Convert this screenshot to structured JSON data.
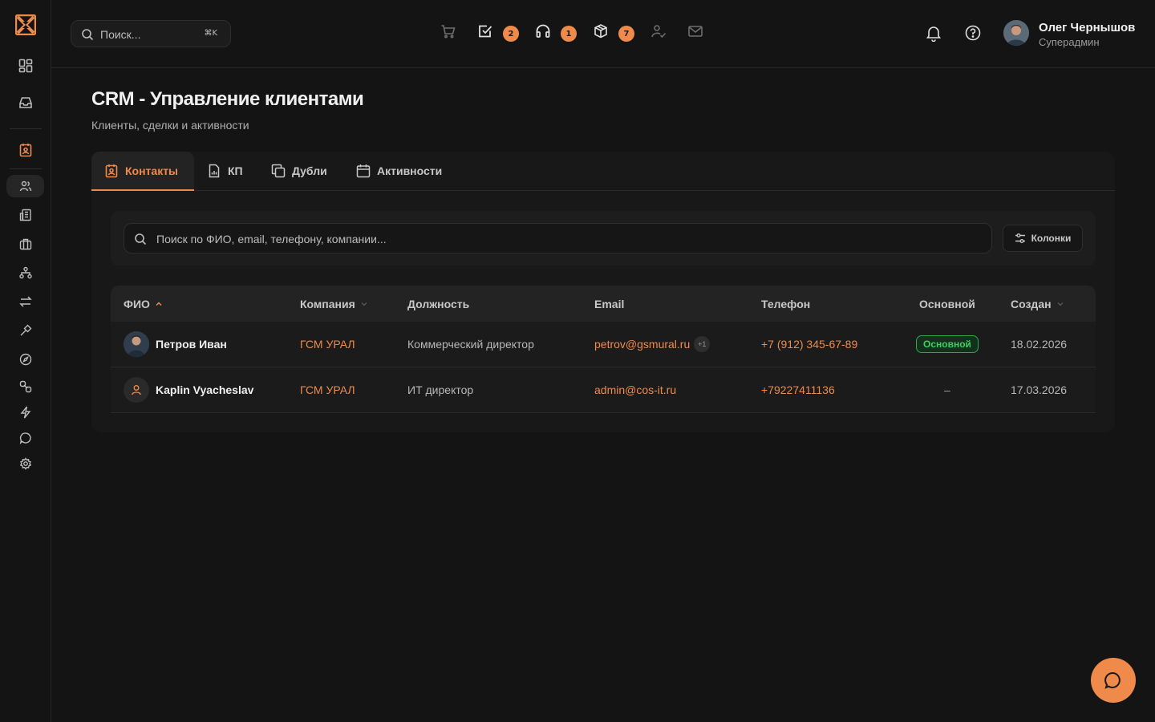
{
  "header": {
    "search": {
      "placeholder": "Поиск...",
      "shortcut": "⌘K"
    },
    "icons": [
      {
        "name": "cart-icon",
        "badge": ""
      },
      {
        "name": "tasks-icon",
        "badge": "2"
      },
      {
        "name": "support-icon",
        "badge": "1"
      },
      {
        "name": "packages-icon",
        "badge": "7"
      },
      {
        "name": "user-check-icon",
        "badge": ""
      },
      {
        "name": "mail-icon",
        "badge": ""
      }
    ],
    "badges": {
      "tasks": "2",
      "support": "1",
      "packages": "7"
    },
    "user": {
      "name": "Олег Чернышов",
      "role": "Суперадмин"
    }
  },
  "sidebar": {
    "items": [
      "dashboard-icon",
      "inbox-icon",
      "crm-contacts-icon",
      "users-icon",
      "buildings-icon",
      "briefcase-icon",
      "hierarchy-icon",
      "exchange-icon",
      "hammer-icon",
      "compass-icon",
      "link-icon",
      "lightning-icon",
      "chat-icon",
      "settings-icon"
    ]
  },
  "page": {
    "title": "CRM - Управление клиентами",
    "subtitle": "Клиенты, сделки и активности"
  },
  "tabs": [
    {
      "label": "Контакты",
      "active": true
    },
    {
      "label": "КП",
      "active": false
    },
    {
      "label": "Дубли",
      "active": false
    },
    {
      "label": "Активности",
      "active": false
    }
  ],
  "filter": {
    "search_placeholder": "Поиск по ФИО, email, телефону, компании...",
    "columns_label": "Колонки"
  },
  "table": {
    "headers": [
      "ФИО",
      "Компания",
      "Должность",
      "Email",
      "Телефон",
      "Основной",
      "Создан"
    ],
    "rows": [
      {
        "name": "Петров Иван",
        "company": "ГСМ УРАЛ",
        "position": "Коммерческий директор",
        "email": "petrov@gsmural.ru",
        "email_extra": "+1",
        "phone": "+7 (912) 345-67-89",
        "primary": "Основной",
        "created": "18.02.2026"
      },
      {
        "name": "Kaplin Vyacheslav",
        "company": "ГСМ УРАЛ",
        "position": "ИТ директор",
        "email": "admin@cos-it.ru",
        "email_extra": "",
        "phone": "+79227411136",
        "primary": "–",
        "created": "17.03.2026"
      }
    ]
  },
  "colors": {
    "accent": "#f08a4b",
    "background": "#141414",
    "success": "#3ecf65"
  }
}
